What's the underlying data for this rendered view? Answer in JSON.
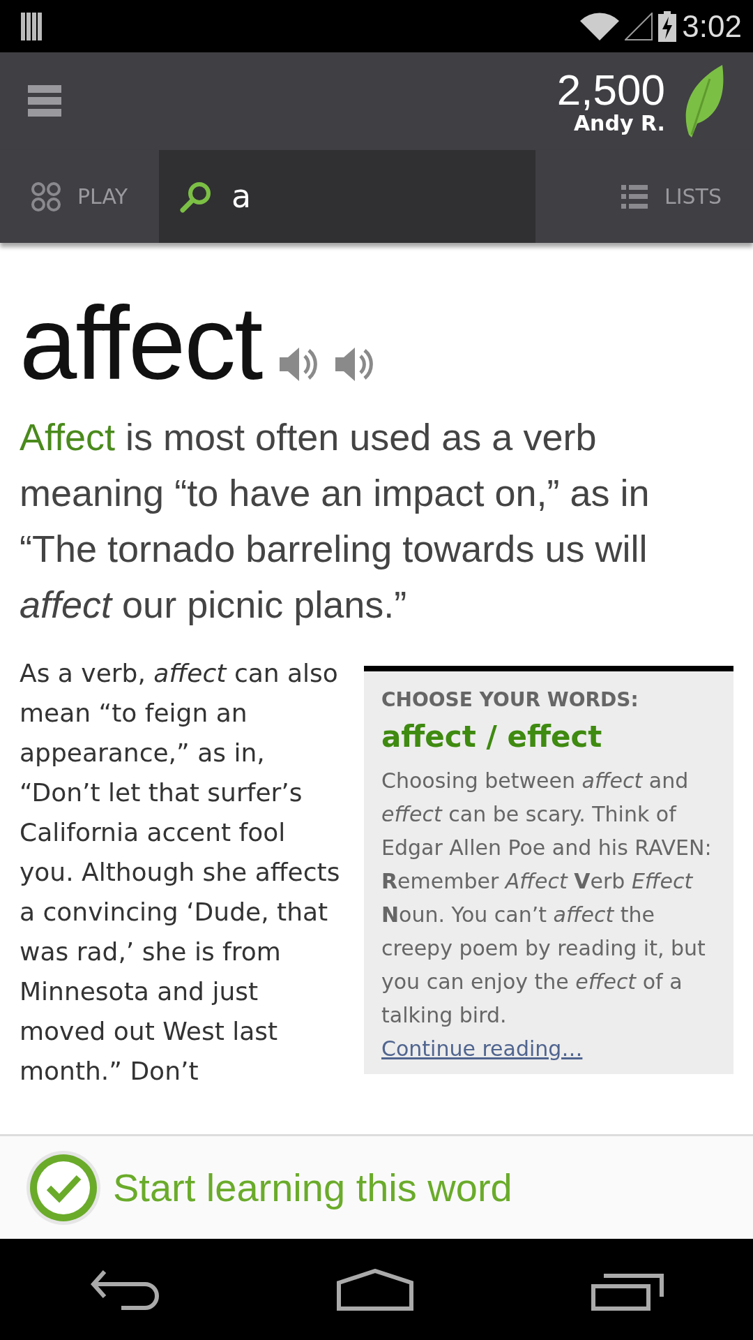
{
  "status_bar": {
    "time": "3:02"
  },
  "header": {
    "score": "2,500",
    "user": "Andy R."
  },
  "tabs": [
    {
      "kind": "tab",
      "label": "PLAY",
      "selected": false
    },
    {
      "kind": "search",
      "value": "a",
      "selected": true
    },
    {
      "kind": "list",
      "label": "LISTS",
      "selected": false
    }
  ],
  "word": {
    "title": "affect"
  },
  "lede": {
    "term": "Affect",
    "text": " is most often used as a verb meaning “to have an impact on,” as in “The tornado barreling towards us will *affect* our picnic plans.”"
  },
  "body": "As a verb, *affect* can also mean “to feign an appearance,” as in, “Don’t let that surfer’s California accent fool you. Although she affects a convincing ‘Dude, that was rad,’ she is from Minnesota and just moved out West last month.” Don’t",
  "sidebar": {
    "heading": "CHOOSE YOUR WORDS:",
    "title": "affect / effect",
    "text": "Choosing between *affect* and *effect* can be scary. Think of Edgar Allen Poe and his RAVEN: **R**emember *Affect* **V**erb *Effect* **N**oun. You can’t *affect* the creepy poem by reading it, but you can enjoy the *effect* of a talking bird.",
    "link": "Continue reading…"
  },
  "cta": {
    "label": "Start learning this word"
  }
}
